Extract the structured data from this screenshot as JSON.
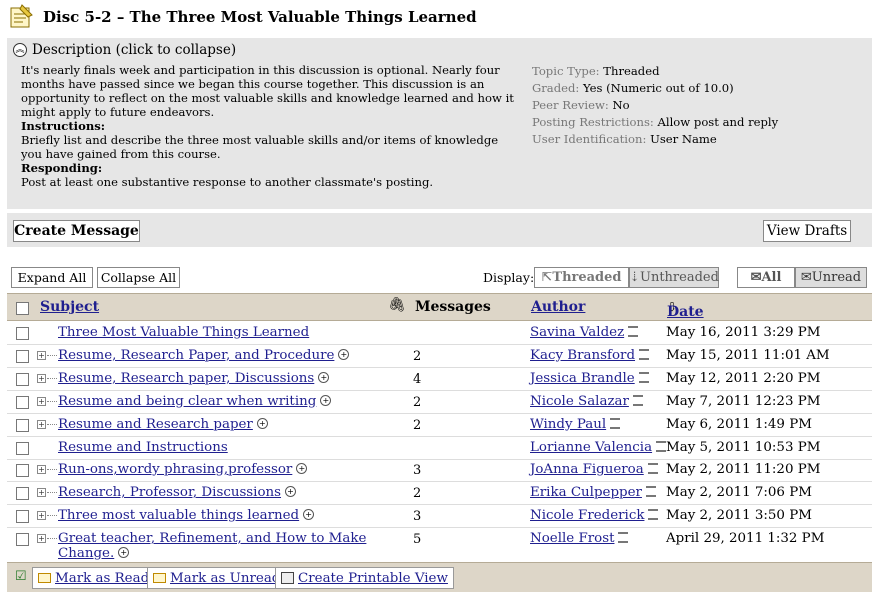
{
  "page": {
    "title": "Disc 5-2 – The Three Most Valuable Things Learned"
  },
  "description": {
    "header": "Description (click to collapse)",
    "intro": "It's nearly finals week and participation in this discussion is optional. Nearly four months have passed since we began this course together. This discussion is an opportunity to reflect on the most valuable skills and knowledge learned and how it might apply to future endeavors.",
    "instructions_label": "Instructions:",
    "instructions_text": "Briefly list and describe the three most valuable skills and/or items of knowledge you have gained from this course.",
    "responding_label": "Responding:",
    "responding_text": "Post at least one substantive response to another classmate's posting."
  },
  "meta": {
    "topic_type_label": "Topic Type:",
    "topic_type": "Threaded",
    "graded_label": "Graded:",
    "graded": "Yes (Numeric out of 10.0)",
    "peer_review_label": "Peer Review:",
    "peer_review": "No",
    "posting_label": "Posting Restrictions:",
    "posting": "Allow post and reply",
    "user_id_label": "User Identification:",
    "user_id": "User Name"
  },
  "toolbar": {
    "create_message": "Create Message",
    "view_drafts": "View Drafts"
  },
  "controls": {
    "expand_all": "Expand All",
    "collapse_all": "Collapse All",
    "display_label": "Display:",
    "threaded": "Threaded",
    "unthreaded": "Unthreaded",
    "all": "All",
    "unread": "Unread"
  },
  "table": {
    "headers": {
      "subject": "Subject",
      "messages": "Messages",
      "author": "Author",
      "date": "Date"
    },
    "rows": [
      {
        "subject": "Three Most Valuable Things Learned",
        "messages": "",
        "author": "Savina Valdez",
        "date": "May 16, 2011 3:29 PM"
      },
      {
        "subject": "Resume, Research Paper, and Procedure",
        "messages": "2",
        "author": "Kacy Bransford",
        "date": "May 15, 2011 11:01 AM"
      },
      {
        "subject": "Resume, Research paper, Discussions",
        "messages": "4",
        "author": "Jessica Brandle",
        "date": "May 12, 2011 2:20 PM"
      },
      {
        "subject": "Resume and being clear when writing",
        "messages": "2",
        "author": "Nicole Salazar",
        "date": "May 7, 2011 12:23 PM"
      },
      {
        "subject": "Resume and Research paper",
        "messages": "2",
        "author": "Windy Paul",
        "date": "May 6, 2011 1:49 PM"
      },
      {
        "subject": "Resume and Instructions",
        "messages": "",
        "author": "Lorianne Valencia",
        "date": "May 5, 2011 10:53 PM"
      },
      {
        "subject": "Run-ons,wordy phrasing,professor",
        "messages": "3",
        "author": "JoAnna Figueroa",
        "date": "May 2, 2011 11:20 PM"
      },
      {
        "subject": "Research, Professor, Discussions",
        "messages": "2",
        "author": "Erika Culpepper",
        "date": "May 2, 2011 7:06 PM"
      },
      {
        "subject": "Three most valuable things learned",
        "messages": "3",
        "author": "Nicole Frederick",
        "date": "May 2, 2011 3:50 PM"
      },
      {
        "subject_line1": "Great teacher, Refinement, and How to Make",
        "subject_line2": "Change.",
        "messages": "5",
        "author": "Noelle Frost",
        "date": "April 29, 2011 1:32 PM"
      }
    ]
  },
  "footer": {
    "mark_read": "Mark as Read",
    "mark_unread": "Mark as Unread",
    "printable": "Create Printable View"
  }
}
